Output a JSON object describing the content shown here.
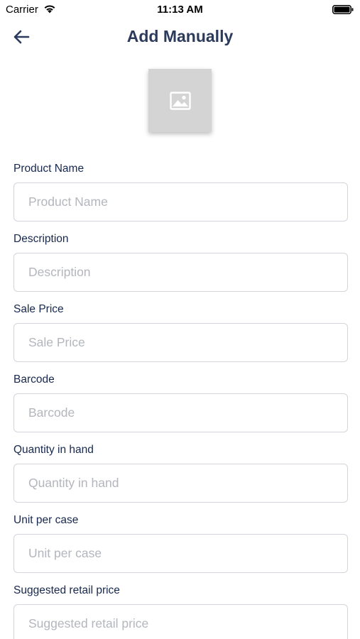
{
  "status_bar": {
    "carrier": "Carrier",
    "time": "11:13 AM",
    "wifi_icon": "wifi-icon",
    "battery_icon": "battery-full-icon"
  },
  "nav": {
    "title": "Add Manually",
    "back_icon": "arrow-left-icon"
  },
  "photo": {
    "icon": "image-placeholder-icon",
    "background": "#d4d4d4"
  },
  "form": {
    "fields": [
      {
        "label": "Product Name",
        "placeholder": "Product Name",
        "value": ""
      },
      {
        "label": "Description",
        "placeholder": "Description",
        "value": ""
      },
      {
        "label": "Sale Price",
        "placeholder": "Sale Price",
        "value": ""
      },
      {
        "label": "Barcode",
        "placeholder": "Barcode",
        "value": ""
      },
      {
        "label": "Quantity in hand",
        "placeholder": "Quantity in hand",
        "value": ""
      },
      {
        "label": "Unit per case",
        "placeholder": "Unit per case",
        "value": ""
      },
      {
        "label": "Suggested retail price",
        "placeholder": "Suggested retail price",
        "value": ""
      }
    ]
  },
  "colors": {
    "title": "#2c3a5c",
    "label": "#17284d",
    "input_border": "#d2d5db",
    "placeholder": "#b3b6bc"
  }
}
